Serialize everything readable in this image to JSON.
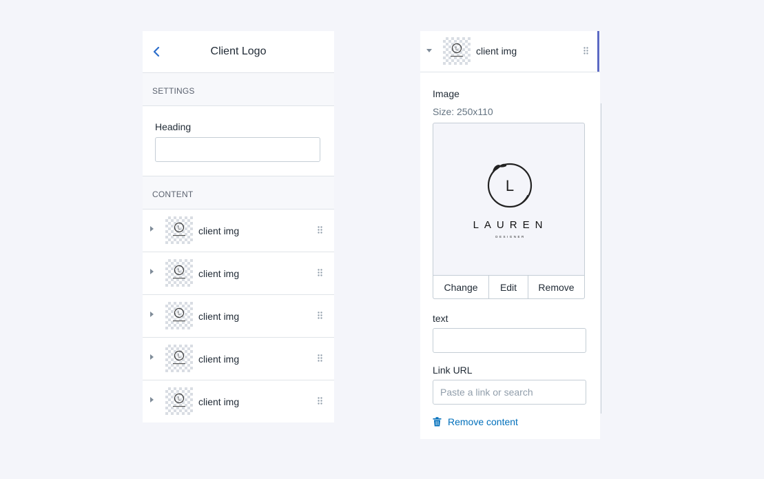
{
  "left_panel": {
    "title": "Client Logo",
    "settings_heading": "SETTINGS",
    "heading_label": "Heading",
    "heading_value": "",
    "content_heading": "CONTENT",
    "items": [
      {
        "label": "client img"
      },
      {
        "label": "client img"
      },
      {
        "label": "client img"
      },
      {
        "label": "client img"
      },
      {
        "label": "client img"
      }
    ]
  },
  "right_panel": {
    "block_label": "client img",
    "image_label": "Image",
    "image_size": "Size: 250x110",
    "logo": {
      "letter": "L",
      "wordmark": "LAUREN",
      "tagline": "DESIGNER"
    },
    "change_label": "Change",
    "edit_label": "Edit",
    "remove_label": "Remove",
    "text_label": "text",
    "text_value": "",
    "link_label": "Link URL",
    "link_placeholder": "Paste a link or search",
    "remove_content_label": "Remove content"
  },
  "colors": {
    "accent": "#5c6ac4",
    "link": "#006fbb",
    "background": "#f4f5fa"
  },
  "icons": [
    "chevron-left-icon",
    "caret-right-icon",
    "caret-down-icon",
    "drag-handle-icon",
    "trash-icon"
  ]
}
